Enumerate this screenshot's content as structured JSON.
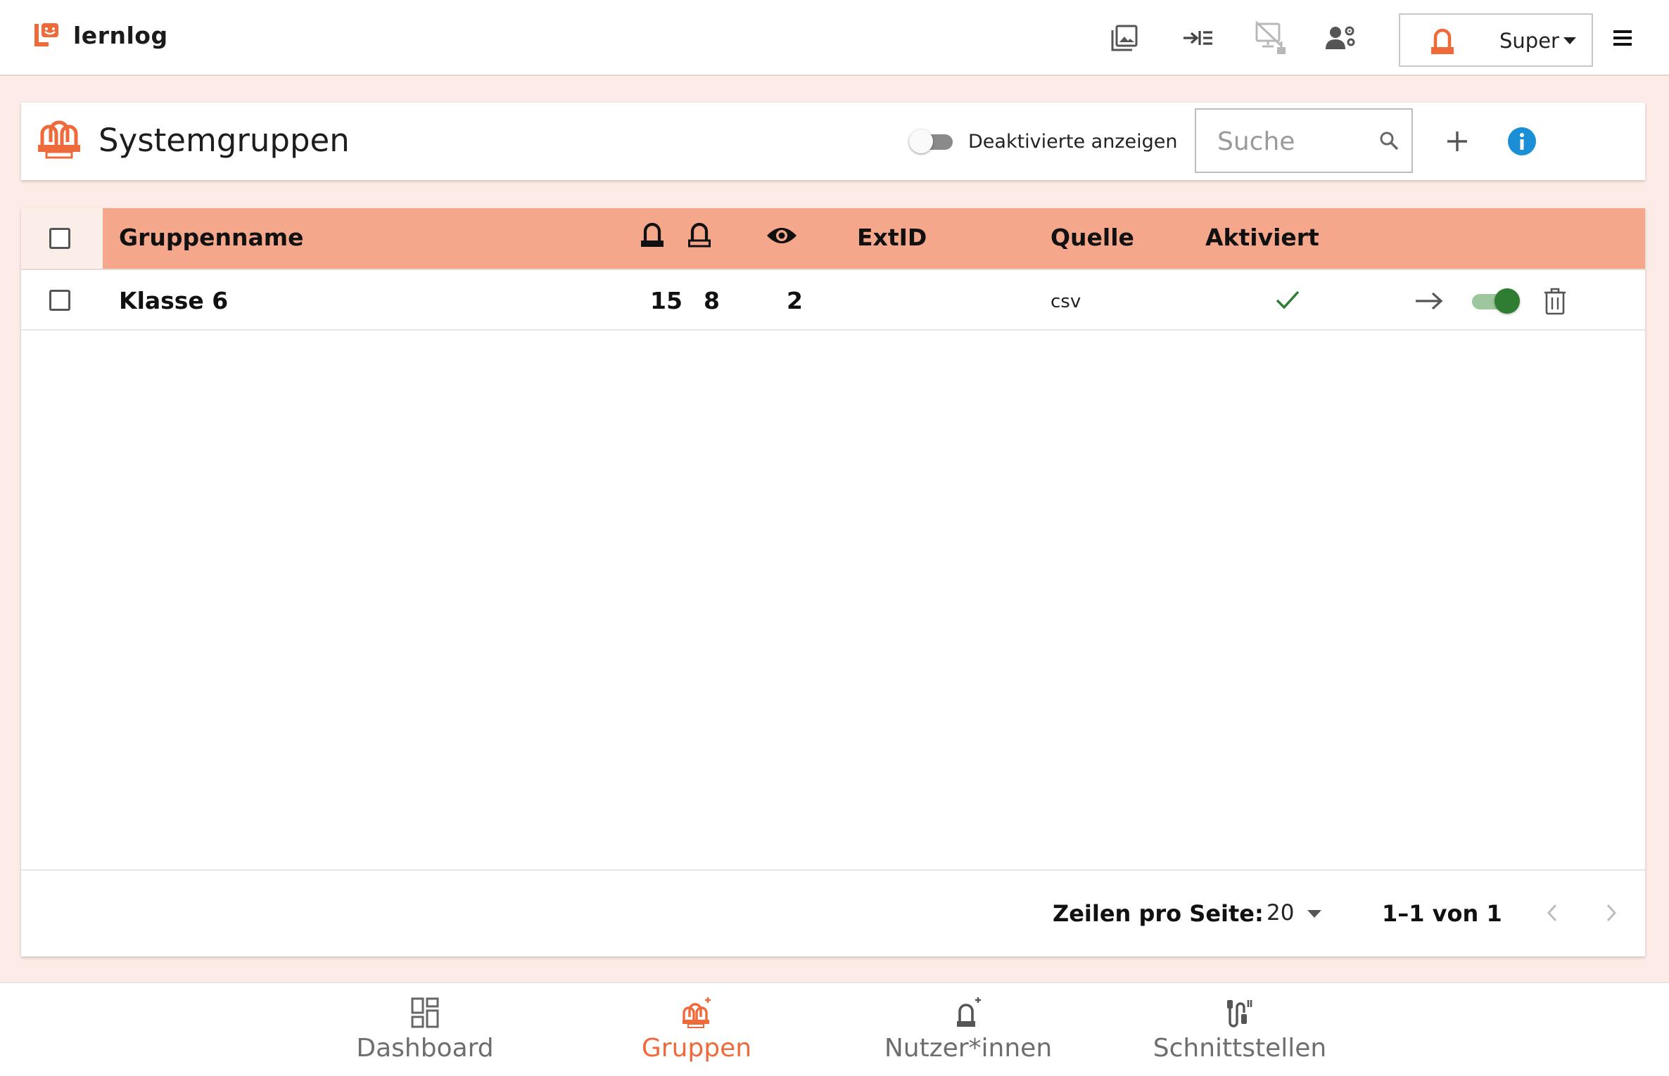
{
  "app": {
    "name": "lernlog"
  },
  "colors": {
    "accent": "#ef6a3a",
    "table_header": "#f4a78b",
    "background": "#fcebe6",
    "active_green": "#2e7d32",
    "info_blue": "#1a8fd6"
  },
  "topbar": {
    "icons": [
      "image-library-icon",
      "login-arrow-icon",
      "screen-clean-icon",
      "user-settings-icon"
    ],
    "role_select": {
      "value": "Super"
    },
    "menu_icon": "hamburger-menu-icon"
  },
  "header": {
    "title": "Systemgruppen",
    "toggle_label": "Deaktivierte anzeigen",
    "toggle_on": false,
    "search_placeholder": "Suche",
    "search_value": ""
  },
  "table": {
    "columns": {
      "name": "Gruppenname",
      "learners_icon": "learner-icon",
      "teachers_icon": "teacher-icon",
      "viewers_icon": "eye-icon",
      "extid": "ExtID",
      "source": "Quelle",
      "active": "Aktiviert"
    },
    "rows": [
      {
        "name": "Klasse 6",
        "learners": "15",
        "teachers": "8",
        "viewers": "2",
        "extid": "",
        "source": "csv",
        "active": true,
        "enabled": true
      }
    ]
  },
  "pagination": {
    "rows_per_page_label": "Zeilen pro Seite:",
    "rows_per_page": "20",
    "range": "1–1 von 1"
  },
  "bottom_nav": {
    "items": [
      {
        "label": "Dashboard",
        "icon": "dashboard-icon",
        "active": false
      },
      {
        "label": "Gruppen",
        "icon": "groups-icon",
        "active": true
      },
      {
        "label": "Nutzer*innen",
        "icon": "users-icon",
        "active": false
      },
      {
        "label": "Schnittstellen",
        "icon": "interfaces-icon",
        "active": false
      }
    ]
  }
}
